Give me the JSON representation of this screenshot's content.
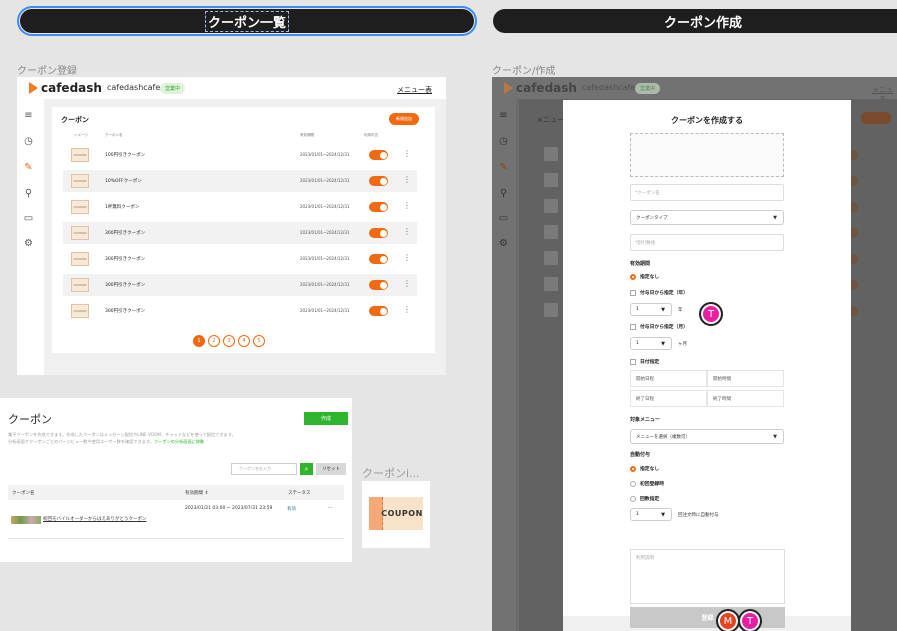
{
  "sections": {
    "left_title": "クーポン一覧",
    "right_title": "クーポン作成"
  },
  "frame_labels": {
    "registration": "クーポン登録",
    "coupon_create": "クーポン/作成",
    "coupon_image": "クーポンi..."
  },
  "header": {
    "brand": "cafedash",
    "shop": "cafedashcafe",
    "status_badge": "営業中",
    "menu_label": "メニュー表"
  },
  "sidebar_icons": [
    "menu-icon",
    "clock-icon",
    "edit-icon",
    "user-icon",
    "monitor-icon",
    "gear-icon"
  ],
  "list_view": {
    "title": "クーポン",
    "new_button": "新規追加",
    "columns": [
      "イメージ",
      "クーポン名",
      "有効期間",
      "利用可否"
    ],
    "thumb_text": "COUPON",
    "rows": [
      {
        "name": "100円引きクーポン",
        "period": "2023/01/01~2024/12/31"
      },
      {
        "name": "10%OFFクーポン",
        "period": "2023/01/01~2024/12/31"
      },
      {
        "name": "1杯無料クーポン",
        "period": "2023/01/01~2024/12/31"
      },
      {
        "name": "300円引きクーポン",
        "period": "2023/01/01~2024/12/31"
      },
      {
        "name": "300円引きクーポン",
        "period": "2023/01/01~2024/12/31"
      },
      {
        "name": "300円引きクーポン",
        "period": "2023/01/01~2024/12/31"
      },
      {
        "name": "300円引きクーポン",
        "period": "2023/01/01~2024/12/31"
      }
    ],
    "pages": [
      "1",
      "2",
      "3",
      "4",
      "5"
    ],
    "current_page": "1"
  },
  "line_view": {
    "title": "クーポン",
    "create_button": "作成",
    "description_1": "電子クーポンを作成できます。作成したクーポンはメッセージ配信やLINE VOOM、チャットなどを使って配信できます。",
    "description_2": "分析画面でクーポンごとのページビュー数や使用ユーザー数を確認できます。",
    "description_link": "クーポンの分析画面に移動",
    "search_placeholder": "クーポン名を入力",
    "reset_button": "リセット",
    "columns": {
      "name": "クーポン名",
      "period": "有効期間",
      "status": "ステータス"
    },
    "sort_mark": "⇕",
    "row": {
      "name": "初回モバイルオーダーからはえありがとうクーポン",
      "period": "2023/01/21 03:00 ~ 2023/07/31 23:59",
      "status": "有効",
      "action": "···"
    }
  },
  "coupon_image": {
    "text": "COUPON"
  },
  "create_modal": {
    "bg_title": "メニュー",
    "title": "クーポンを作成する",
    "name_placeholder": "*クーポン名",
    "type_select": "クーポンタイプ",
    "discount_placeholder": "*割引数値",
    "validity_label": "有効期間",
    "validity_options": {
      "none": "指定なし",
      "from_grant_years": "付与日から指定（年）",
      "from_grant_months": "付与日から指定（月）",
      "date": "日付指定"
    },
    "years_value": "1",
    "years_unit": "年",
    "months_value": "1",
    "months_unit": "ヶ月",
    "start_date": "開始日程",
    "start_time": "開始時間",
    "end_date": "終了日程",
    "end_time": "終了時間",
    "target_menu_label": "対象メニュー",
    "target_menu_select": "メニューを選択（複数可）",
    "auto_grant_label": "自動付与",
    "auto_grant_options": {
      "none": "指定なし",
      "first_register": "初回登録時",
      "count": "回数指定"
    },
    "count_value": "1",
    "count_unit": "回注文時に自動付与",
    "usage_placeholder": "利用説明",
    "submit_button": "登録"
  },
  "collaborators": {
    "m": "M",
    "t": "T"
  },
  "colors": {
    "accent_orange": "#f06a13",
    "line_green": "#2db52d",
    "avatar_pink": "#e91ea0",
    "avatar_red": "#e8401c"
  }
}
